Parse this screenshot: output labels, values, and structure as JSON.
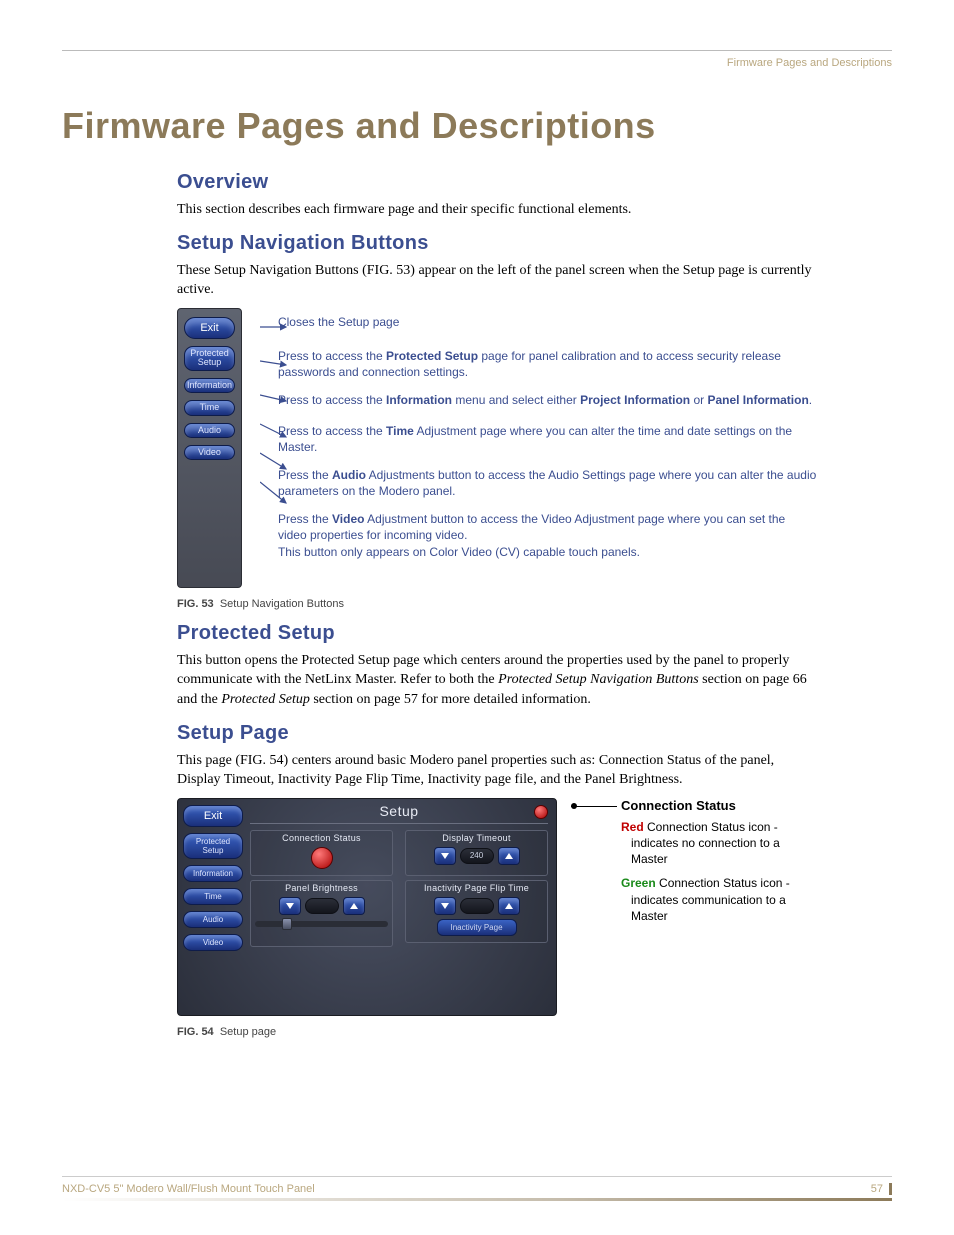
{
  "header": {
    "label": "Firmware Pages and Descriptions"
  },
  "title": "Firmware Pages and Descriptions",
  "sections": {
    "overview": {
      "heading": "Overview",
      "body": "This section describes each firmware page and their specific functional elements."
    },
    "setupNav": {
      "heading": "Setup Navigation Buttons",
      "body": "These Setup Navigation Buttons (FIG. 53) appear on the left of the panel screen when the Setup page is currently active."
    },
    "protected": {
      "heading": "Protected Setup",
      "body_a": "This button opens the Protected Setup page which centers around the properties used by the panel to properly communicate with the NetLinx Master. Refer to both the ",
      "body_b_italic": "Protected Setup Navigation Buttons",
      "body_c": " section on page 66 and the ",
      "body_d_italic": "Protected Setup",
      "body_e": " section on page 57 for more detailed information."
    },
    "setupPage": {
      "heading": "Setup Page",
      "body": "This page (FIG. 54) centers around basic Modero panel properties such as: Connection Status of the panel, Display Timeout, Inactivity Page Flip Time, Inactivity page file, and the Panel Brightness."
    }
  },
  "fig53": {
    "caption_tag": "FIG. 53",
    "caption_text": "Setup Navigation Buttons",
    "buttons": {
      "exit": "Exit",
      "protected_l1": "Protected",
      "protected_l2": "Setup",
      "information": "Information",
      "time": "Time",
      "audio": "Audio",
      "video": "Video"
    },
    "desc": {
      "exit": "Closes the Setup page",
      "protected_a": "Press to access the ",
      "protected_b_bold": "Protected Setup",
      "protected_c": " page for panel calibration and to access security release passwords and connection settings.",
      "info_a": "Press to access the ",
      "info_b_bold": "Information",
      "info_c": " menu and select either ",
      "info_d_bold": "Project Information",
      "info_e": " or ",
      "info_f_bold": "Panel Information",
      "info_g": ".",
      "time_a": "Press to access the ",
      "time_b_bold": "Time",
      "time_c": " Adjustment page where you can alter the time and date settings on the Master.",
      "audio_a": "Press the ",
      "audio_b_bold": "Audio",
      "audio_c": " Adjustments button to access the Audio Settings page where you can alter the audio parameters on the Modero panel.",
      "video_a": "Press the ",
      "video_b_bold": "Video",
      "video_c": " Adjustment button to access the Video Adjustment page where you can set the video properties for incoming video.",
      "video_d": "This button only appears on Color Video (CV) capable touch panels."
    }
  },
  "fig54": {
    "caption_tag": "FIG. 54",
    "caption_text": "Setup page",
    "panel": {
      "title": "Setup",
      "exit": "Exit",
      "side": {
        "protected_l1": "Protected",
        "protected_l2": "Setup",
        "information": "Information",
        "time": "Time",
        "audio": "Audio",
        "video": "Video"
      },
      "groups": {
        "conn": "Connection Status",
        "disp": "Display Timeout",
        "disp_val": "240",
        "inact": "Inactivity Page Flip Time",
        "inact_btn": "Inactivity Page",
        "bright": "Panel Brightness"
      }
    },
    "right": {
      "title": "Connection Status",
      "red_label": "Red",
      "red_text": " Connection Status icon - indicates no connection to a Master",
      "green_label": "Green",
      "green_text": " Connection Status icon - indicates communication to a Master"
    }
  },
  "footer": {
    "product": "NXD-CV5 5\" Modero Wall/Flush Mount Touch Panel",
    "page": "57"
  }
}
